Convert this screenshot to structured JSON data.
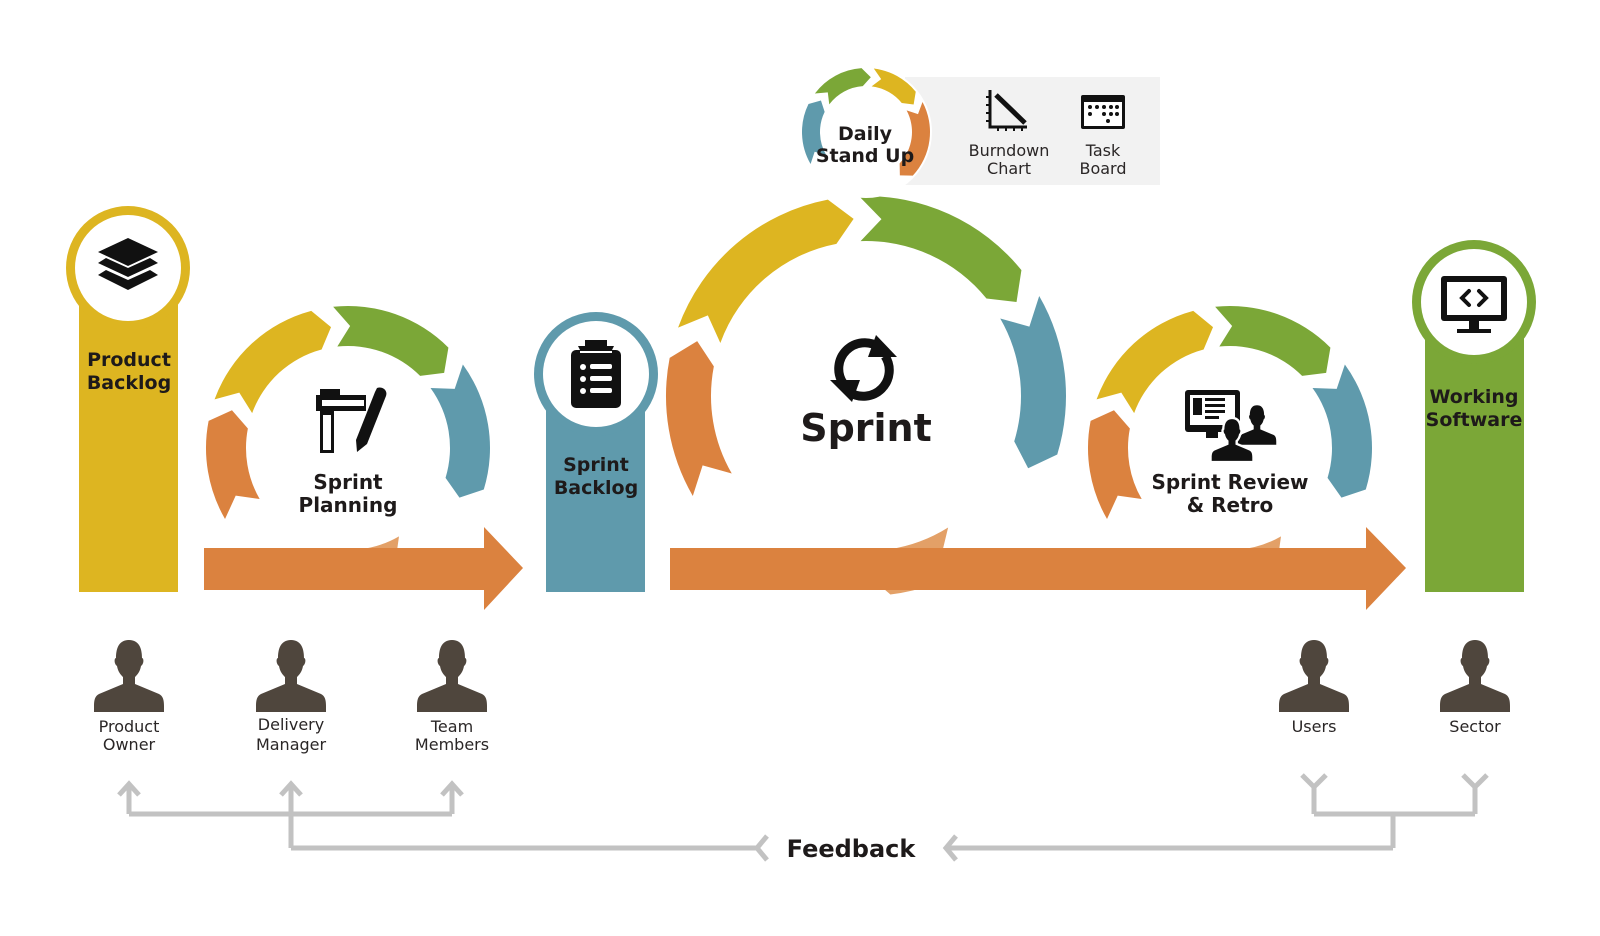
{
  "colors": {
    "yellow": "#DDB521",
    "green": "#7BA737",
    "blue": "#5F9AAC",
    "orange": "#DB823F",
    "orange_light": "#E3A067",
    "person": "#4F463D",
    "feedback_line": "#C2C2C2",
    "tools_panel": "#F2F2F2",
    "text": "#1E1A1A"
  },
  "pillars": [
    {
      "id": "product-backlog",
      "line1": "Product",
      "line2": "Backlog",
      "icon": "layers-icon",
      "color": "yellow"
    },
    {
      "id": "sprint-backlog",
      "line1": "Sprint",
      "line2": "Backlog",
      "icon": "clipboard-list-icon",
      "color": "blue"
    },
    {
      "id": "working-software",
      "line1": "Working",
      "line2": "Software",
      "icon": "monitor-code-icon",
      "color": "green"
    }
  ],
  "cycles": {
    "sprint_planning": {
      "line1": "Sprint",
      "line2": "Planning",
      "icon": "ruler-pencil-icon"
    },
    "sprint": {
      "label": "Sprint",
      "icon": "refresh-icon"
    },
    "sprint_review": {
      "line1": "Sprint Review",
      "line2": "& Retro",
      "icon": "presentation-people-icon"
    },
    "daily_standup": {
      "line1": "Daily",
      "line2": "Stand Up"
    }
  },
  "tools": [
    {
      "line1": "Burndown",
      "line2": "Chart",
      "icon": "burndown-chart-icon"
    },
    {
      "line1": "Task",
      "line2": "Board",
      "icon": "task-board-icon"
    }
  ],
  "people": [
    {
      "line1": "Product",
      "line2": "Owner"
    },
    {
      "line1": "Delivery",
      "line2": "Manager"
    },
    {
      "line1": "Team",
      "line2": "Members"
    },
    {
      "line1": "Users",
      "line2": ""
    },
    {
      "line1": "Sector",
      "line2": ""
    }
  ],
  "feedback": {
    "label": "Feedback"
  }
}
